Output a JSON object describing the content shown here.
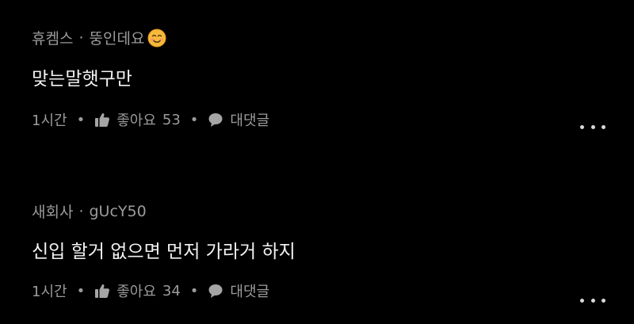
{
  "comments": [
    {
      "author": "휴켐스",
      "separator": "·",
      "nickname": "뚱인데요",
      "emoji_icon": "smiling-face-icon",
      "text": "맞는말햇구만",
      "time": "1시간",
      "action_separator": "•",
      "like_label": "좋아요",
      "like_count": "53",
      "reply_label": "대댓글"
    },
    {
      "author": "새회사",
      "separator": "·",
      "nickname": "gUcY50",
      "text": "신입 할거 없으면 먼저 가라거 하지",
      "time": "1시간",
      "action_separator": "•",
      "like_label": "좋아요",
      "like_count": "34",
      "reply_label": "대댓글"
    }
  ],
  "icons": {
    "like": "thumbs-up-icon",
    "reply": "speech-bubble-icon",
    "more": "more-dots-icon"
  },
  "colors": {
    "background": "#000000",
    "text_primary": "#f2f2f2",
    "text_secondary": "#9b9b9b",
    "emoji": "#f6b93b"
  }
}
